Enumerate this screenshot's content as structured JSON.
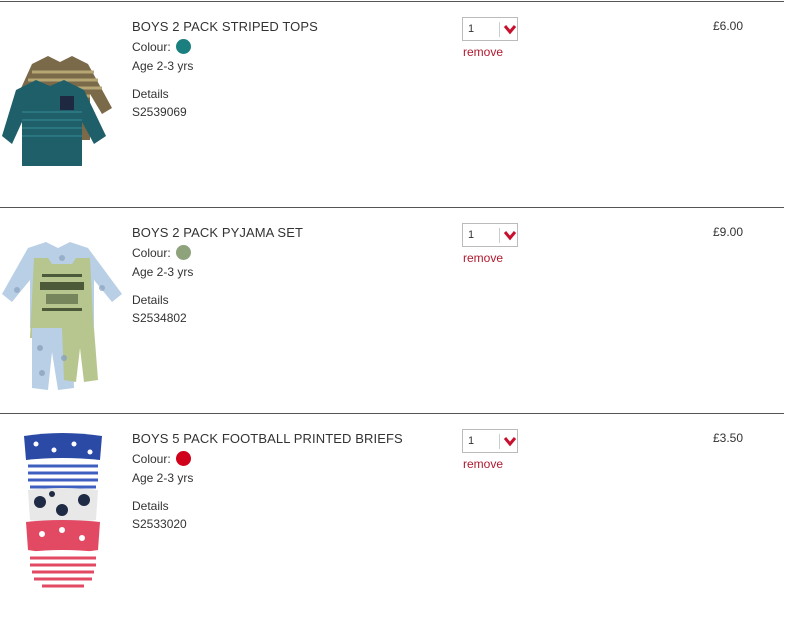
{
  "items": [
    {
      "title": "BOYS 2 PACK STRIPED TOPS",
      "colour_label": "Colour:",
      "colour_hex": "#1b7f7f",
      "age": "Age 2-3 yrs",
      "details_label": "Details",
      "sku": "S2539069",
      "quantity": "1",
      "remove_label": "remove",
      "price": "£6.00"
    },
    {
      "title": "BOYS 2 PACK PYJAMA SET",
      "colour_label": "Colour:",
      "colour_hex": "#8ea37c",
      "age": "Age 2-3 yrs",
      "details_label": "Details",
      "sku": "S2534802",
      "quantity": "1",
      "remove_label": "remove",
      "price": "£9.00"
    },
    {
      "title": "BOYS 5 PACK FOOTBALL PRINTED BRIEFS",
      "colour_label": "Colour:",
      "colour_hex": "#d0021b",
      "age": "Age 2-3 yrs",
      "details_label": "Details",
      "sku": "S2533020",
      "quantity": "1",
      "remove_label": "remove",
      "price": "£3.50"
    }
  ],
  "accent_color": "#b0192f"
}
